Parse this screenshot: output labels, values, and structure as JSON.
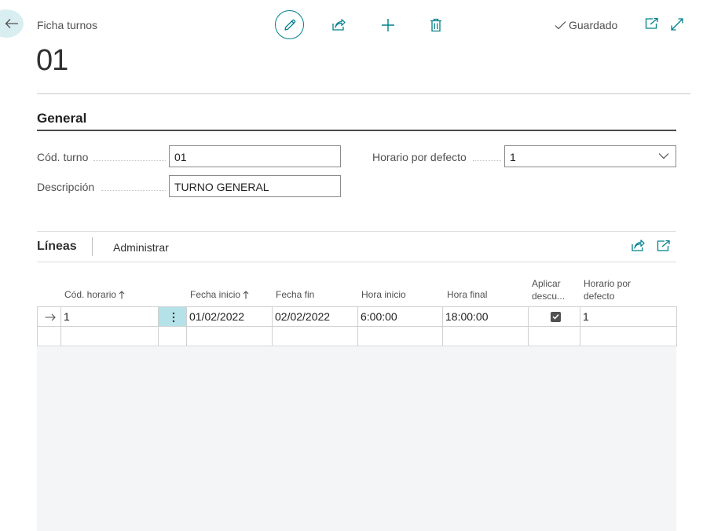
{
  "header": {
    "caption": "Ficha turnos",
    "record_title": "01",
    "saved_label": "Guardado"
  },
  "general": {
    "title": "General",
    "shift_code_label": "Cód. turno",
    "shift_code_value": "01",
    "description_label": "Descripción",
    "description_value": "TURNO GENERAL",
    "default_schedule_label": "Horario por defecto",
    "default_schedule_value": "1"
  },
  "lines": {
    "title": "Líneas",
    "action_manage": "Administrar",
    "columns": {
      "schedule_code": "Cód. horario",
      "start_date": "Fecha inicio",
      "end_date": "Fecha fin",
      "start_time": "Hora inicio",
      "end_time": "Hora final",
      "apply_discount_1": "Aplicar",
      "apply_discount_2": "descu...",
      "default_schedule_1": "Horario por",
      "default_schedule_2": "defecto"
    },
    "rows": [
      {
        "schedule_code": "1",
        "start_date": "01/02/2022",
        "end_date": "02/02/2022",
        "start_time": "6:00:00",
        "end_time": "18:00:00",
        "apply_discount": true,
        "default_schedule": "1"
      }
    ]
  },
  "icons": {
    "back": "arrow-left-icon",
    "edit": "pencil-icon",
    "share": "share-icon",
    "new": "plus-icon",
    "delete": "trash-icon",
    "saved": "checkmark-icon",
    "open_new_window": "open-new-window-icon",
    "expand": "expand-icon",
    "sort": "arrow-up-icon",
    "row_marker": "arrow-right-icon",
    "row_menu": "vertical-ellipsis-icon",
    "dropdown": "chevron-down-icon"
  },
  "colors": {
    "accent": "#00808c",
    "selected_cell": "#b5e2e8"
  }
}
